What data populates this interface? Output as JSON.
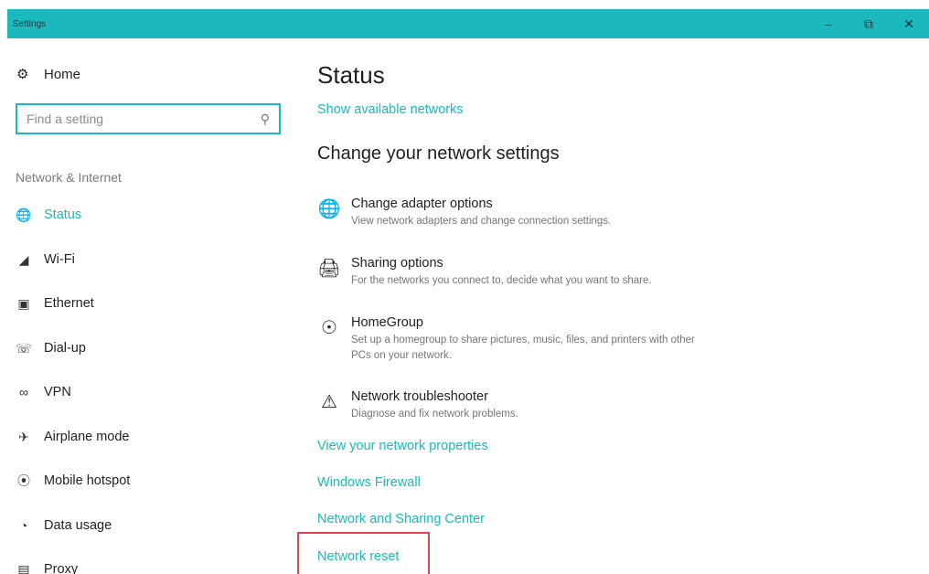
{
  "window": {
    "title": "Settings",
    "controls": {
      "minimize": "–",
      "restore": "⧉",
      "close": "✕"
    },
    "accent": "#1bb8be"
  },
  "sidebar": {
    "home": {
      "label": "Home",
      "icon": "gear-icon"
    },
    "search": {
      "placeholder": "Find a setting",
      "icon": "search-icon"
    },
    "section_label": "Network & Internet",
    "items": [
      {
        "label": "Status",
        "icon": "globe-icon",
        "active": true
      },
      {
        "label": "Wi-Fi",
        "icon": "wifi-icon"
      },
      {
        "label": "Ethernet",
        "icon": "ethernet-icon"
      },
      {
        "label": "Dial-up",
        "icon": "dialup-icon"
      },
      {
        "label": "VPN",
        "icon": "vpn-icon"
      },
      {
        "label": "Airplane mode",
        "icon": "airplane-icon"
      },
      {
        "label": "Mobile hotspot",
        "icon": "hotspot-icon"
      },
      {
        "label": "Data usage",
        "icon": "data-usage-icon"
      },
      {
        "label": "Proxy",
        "icon": "proxy-icon"
      }
    ]
  },
  "main": {
    "title": "Status",
    "show_networks_link": "Show available networks",
    "subheading": "Change your network settings",
    "options": [
      {
        "title": "Change adapter options",
        "desc": "View network adapters and change connection settings.",
        "icon": "adapter-icon"
      },
      {
        "title": "Sharing options",
        "desc": "For the networks you connect to, decide what you want to share.",
        "icon": "sharing-icon"
      },
      {
        "title": "HomeGroup",
        "desc": "Set up a homegroup to share pictures, music, files, and printers with other PCs on your network.",
        "icon": "homegroup-icon"
      },
      {
        "title": "Network troubleshooter",
        "desc": "Diagnose and fix network problems.",
        "icon": "warning-icon"
      }
    ],
    "links": [
      "View your network properties",
      "Windows Firewall",
      "Network and Sharing Center",
      "Network reset"
    ],
    "highlight_color": "#e0454f"
  }
}
